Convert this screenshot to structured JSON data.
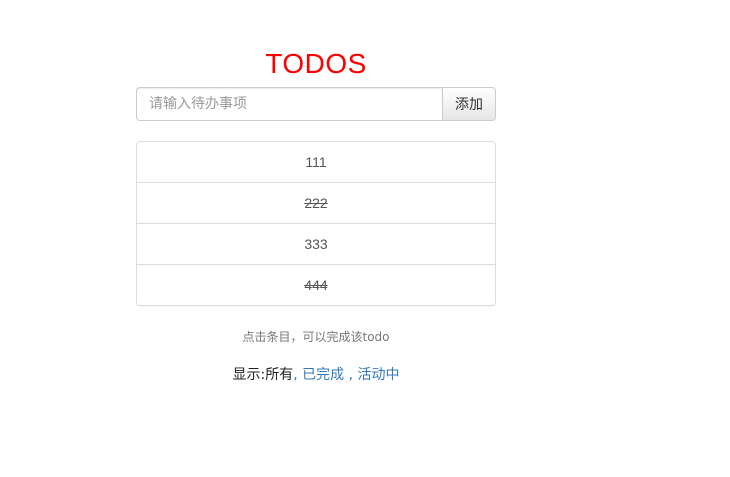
{
  "header": {
    "title": "TODOS"
  },
  "input": {
    "placeholder": "请输入待办事项",
    "value": "",
    "add_label": "添加"
  },
  "todos": [
    {
      "text": "111",
      "done": false
    },
    {
      "text": "222",
      "done": true
    },
    {
      "text": "333",
      "done": false
    },
    {
      "text": "444",
      "done": true
    }
  ],
  "hint": "点击条目，可以完成该todo",
  "filter": {
    "prefix": "显示:",
    "all": "所有",
    "sep1": ",",
    "completed": "已完成",
    "sep2": ",",
    "active": "活动中"
  },
  "colors": {
    "title": "#ff0000",
    "link": "#337ab7"
  }
}
